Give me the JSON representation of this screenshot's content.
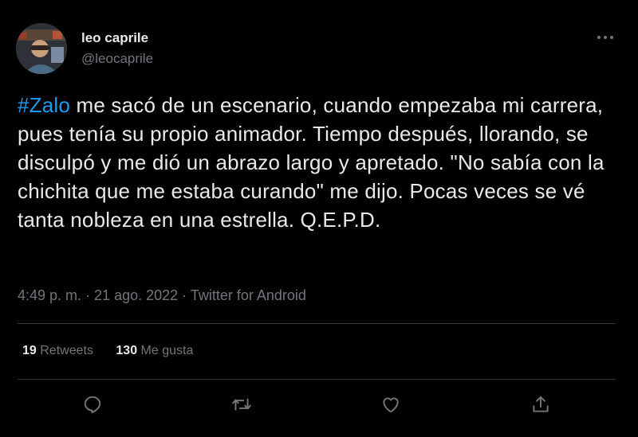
{
  "author": {
    "display_name": "leo caprile",
    "handle": "@leocaprile"
  },
  "tweet": {
    "hashtag": "#Zalo",
    "body": " me sacó de un escenario, cuando empezaba mi carrera, pues tenía su propio animador. Tiempo después, llorando, se disculpó y me dió un abrazo largo y apretado. \"No sabía con la chichita que me estaba curando\" me dijo. Pocas veces se vé tanta nobleza en una estrella. Q.E.P.D."
  },
  "meta": {
    "time": "4:49 p. m.",
    "separator": " · ",
    "date": "21 ago. 2022",
    "source": "Twitter for Android"
  },
  "stats": {
    "retweets_count": "19",
    "retweets_label": " Retweets",
    "likes_count": "130",
    "likes_label": " Me gusta"
  },
  "icons": {
    "more": "more-icon",
    "reply": "reply-icon",
    "retweet": "retweet-icon",
    "like": "like-icon",
    "share": "share-icon"
  },
  "colors": {
    "background": "#000000",
    "text": "#e7e9ea",
    "secondary": "#71767b",
    "accent": "#1d9bf0",
    "divider": "#2f3336"
  }
}
